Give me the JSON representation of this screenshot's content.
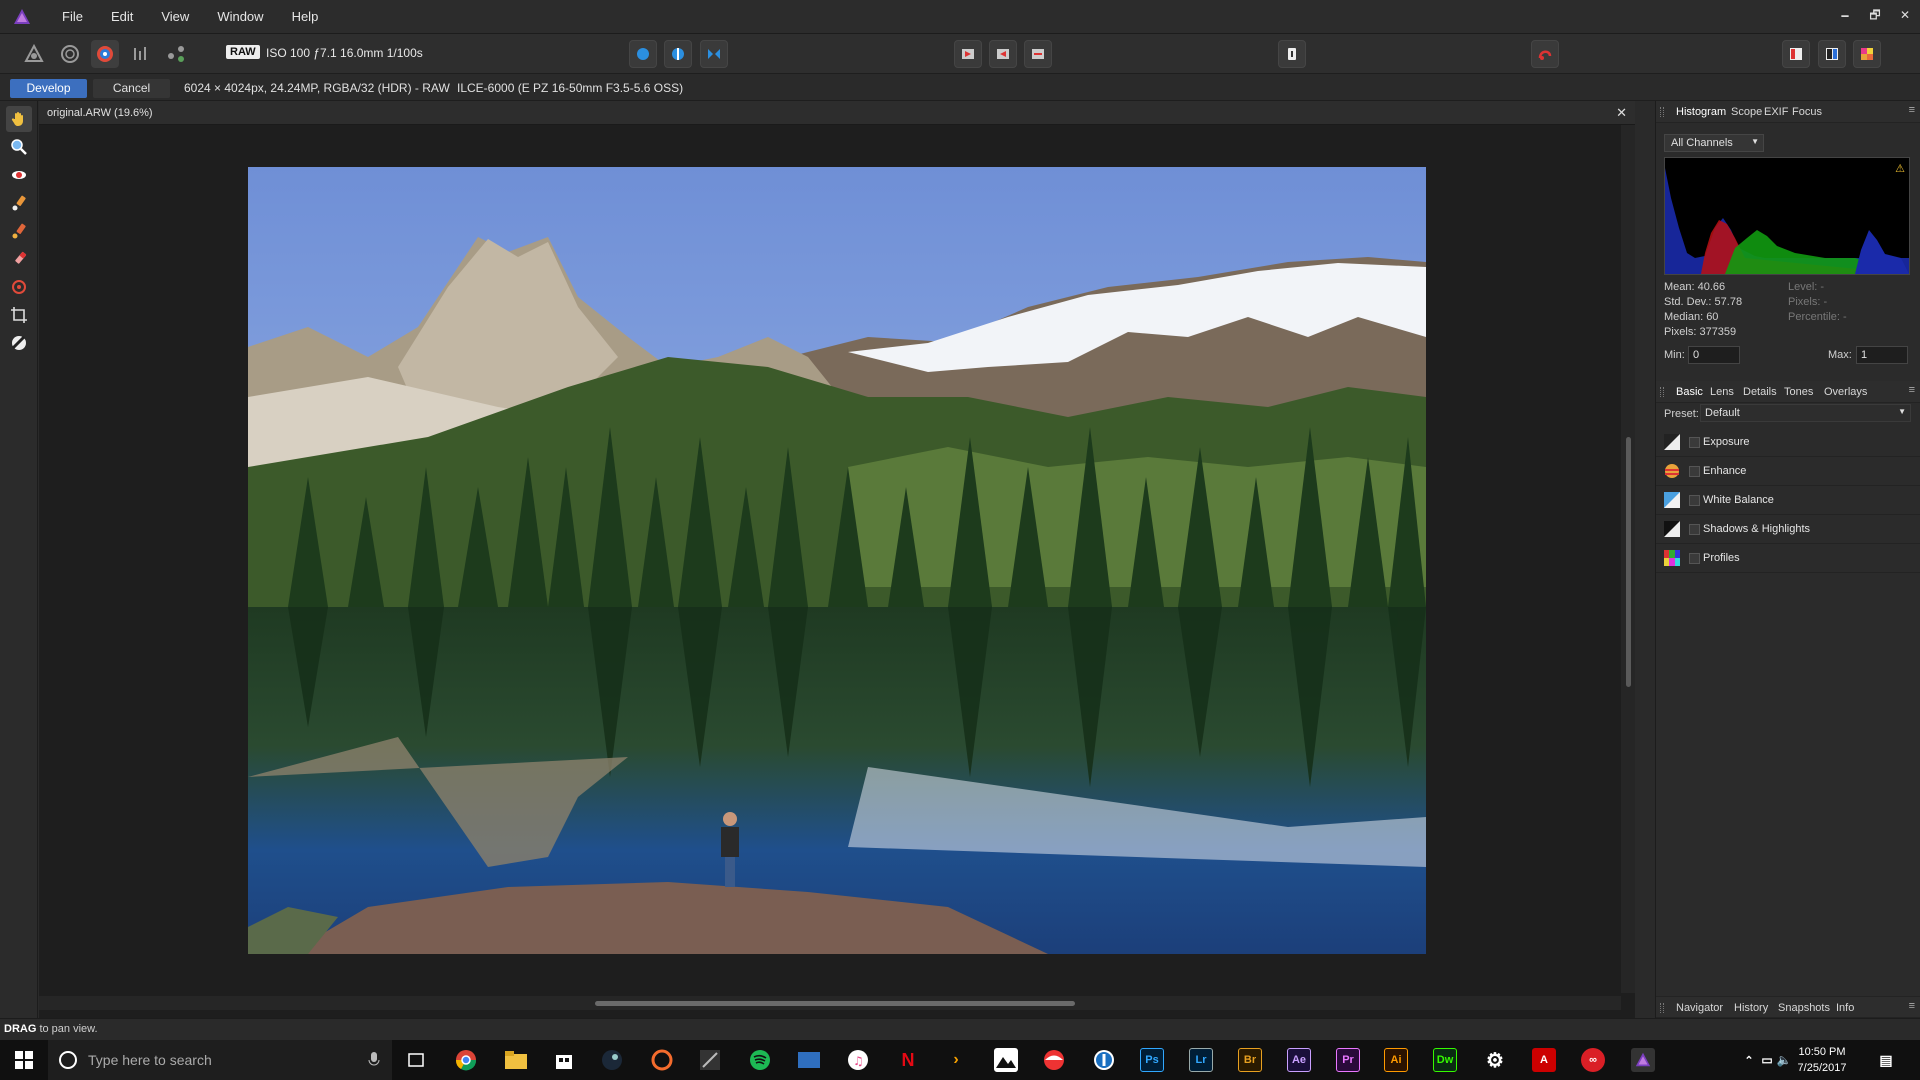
{
  "app": {
    "name": "Affinity Photo"
  },
  "menu": [
    "File",
    "Edit",
    "View",
    "Window",
    "Help"
  ],
  "window_controls": {
    "minimize": "🗕",
    "restore": "🗗",
    "close": "✕"
  },
  "toolbar": {
    "raw_badge": "RAW",
    "raw_info": "ISO 100 ƒ7.1 16.0mm 1/100s"
  },
  "context": {
    "develop_label": "Develop",
    "cancel_label": "Cancel",
    "image_info": "6024 × 4024px, 24.24MP, RGBA/32 (HDR) - RAW",
    "camera_info": "ILCE-6000 (E PZ 16-50mm F3.5-5.6 OSS)"
  },
  "document": {
    "tab_title": "original.ARW (19.6%)",
    "close": "✕"
  },
  "histogram_panel": {
    "tabs": [
      "Histogram",
      "Scope",
      "EXIF",
      "Focus"
    ],
    "channel": "All Channels",
    "stats_left": [
      "Mean: 40.66",
      "Std. Dev.: 57.78",
      "Median: 60",
      "Pixels: 377359"
    ],
    "stats_right": [
      "Level: -",
      "Pixels: -",
      "Percentile: -"
    ],
    "min_label": "Min:",
    "min_value": "0",
    "max_label": "Max:",
    "max_value": "1",
    "warning_icon": "warning-icon"
  },
  "adjust_panel": {
    "tabs": [
      "Basic",
      "Lens",
      "Details",
      "Tones",
      "Overlays"
    ],
    "preset_label": "Preset:",
    "preset_value": "Default",
    "items": [
      {
        "label": "Exposure",
        "icon": "exposure-icon"
      },
      {
        "label": "Enhance",
        "icon": "enhance-icon"
      },
      {
        "label": "White Balance",
        "icon": "white-balance-icon"
      },
      {
        "label": "Shadows & Highlights",
        "icon": "shadows-highlights-icon"
      },
      {
        "label": "Profiles",
        "icon": "profiles-icon"
      }
    ]
  },
  "bottom_tabs": [
    "Navigator",
    "History",
    "Snapshots",
    "Info"
  ],
  "status": {
    "key": "DRAG",
    "text": " to pan view."
  },
  "taskbar": {
    "search_placeholder": "Type here to search",
    "time": "10:50 PM",
    "date": "7/25/2017",
    "apps": [
      "Ps",
      "Lr",
      "Br",
      "Ae",
      "Pr",
      "Ai",
      "Dw"
    ]
  },
  "colors": {
    "accent": "#3c6fbf"
  }
}
